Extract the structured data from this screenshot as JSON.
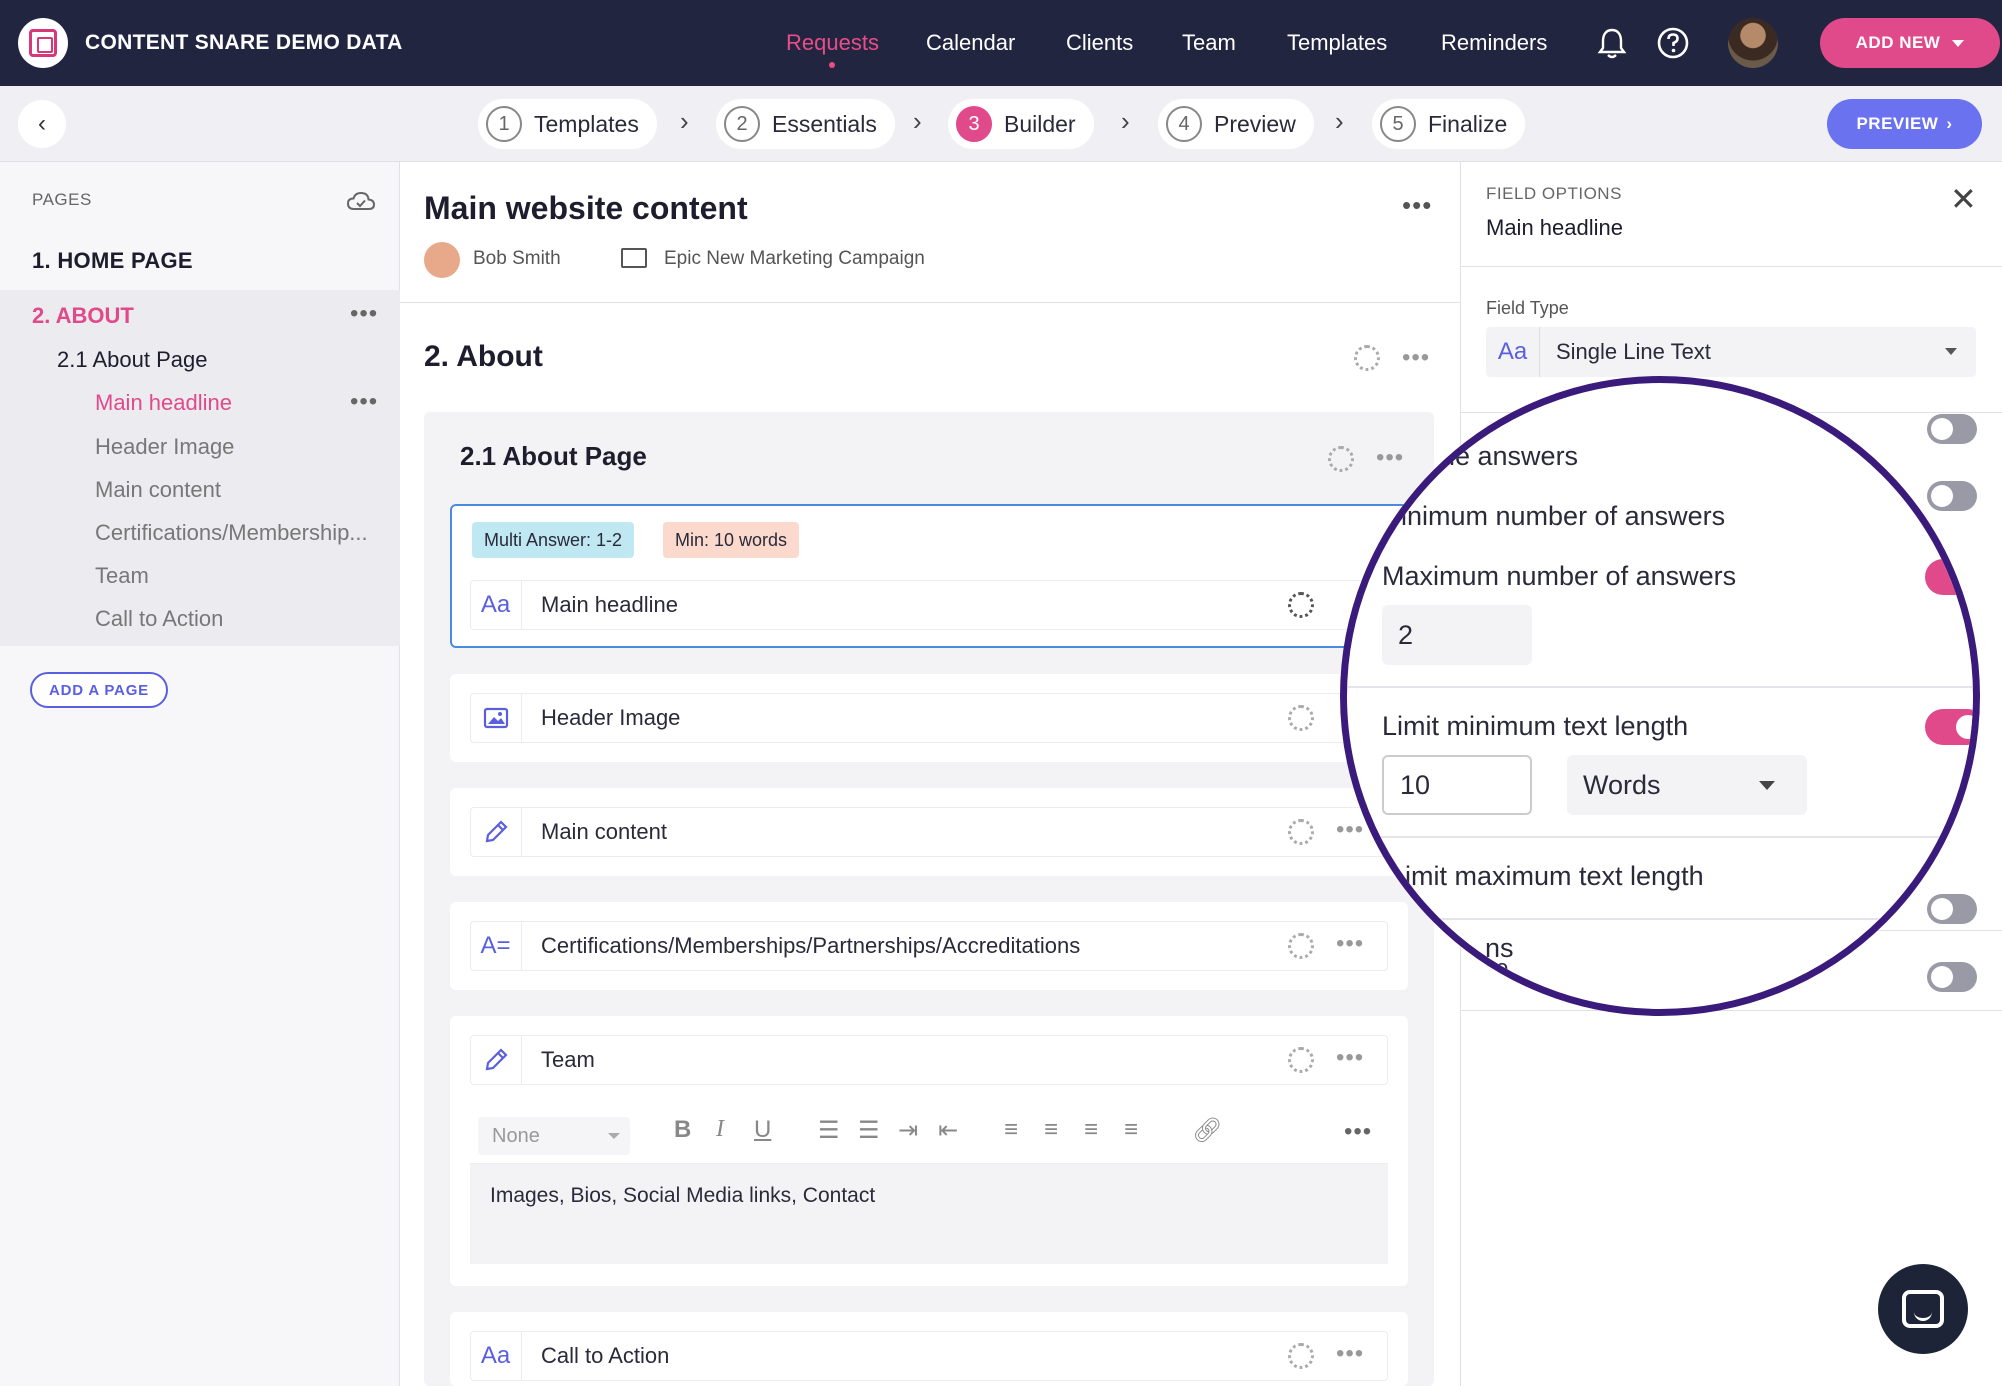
{
  "app": {
    "brand": "CONTENT SNARE DEMO DATA",
    "nav": [
      "Requests",
      "Calendar",
      "Clients",
      "Team",
      "Templates",
      "Reminders"
    ],
    "active_nav": "Requests",
    "add_new": "ADD NEW",
    "accent": "#e04a8a",
    "nav_bg": "#222540"
  },
  "steps": [
    {
      "num": "1",
      "label": "Templates"
    },
    {
      "num": "2",
      "label": "Essentials"
    },
    {
      "num": "3",
      "label": "Builder"
    },
    {
      "num": "4",
      "label": "Preview"
    },
    {
      "num": "5",
      "label": "Finalize"
    }
  ],
  "active_step": "Builder",
  "preview_btn": "PREVIEW",
  "sidebar": {
    "heading": "PAGES",
    "pages": [
      {
        "label": "1. HOME PAGE"
      },
      {
        "label": "2. ABOUT"
      }
    ],
    "subpage": "2.1 About Page",
    "fields": [
      "Main headline",
      "Header Image",
      "Main content",
      "Certifications/Membership...",
      "Team",
      "Call to Action"
    ],
    "add_page": "ADD A PAGE"
  },
  "main": {
    "title": "Main website content",
    "owner": "Bob Smith",
    "campaign": "Epic New Marketing Campaign",
    "section": "2.  About",
    "subsection": "2.1  About Page",
    "tags": [
      "Multi Answer: 1-2",
      "Min: 10 words"
    ],
    "fields": [
      {
        "label": "Main headline",
        "icon": "Aa"
      },
      {
        "label": "Header Image",
        "icon": "image-icon"
      },
      {
        "label": "Main content",
        "icon": "pencil-icon"
      },
      {
        "label": "Certifications/Memberships/Partnerships/Accreditations",
        "icon": "A="
      },
      {
        "label": "Team",
        "icon": "pencil-icon"
      },
      {
        "label": "Call to Action",
        "icon": "Aa"
      }
    ],
    "editor": {
      "style_select": "None",
      "content": "Images, Bios, Social Media links, Contact"
    }
  },
  "field_options": {
    "heading": "FIELD OPTIONS",
    "title": "Main headline",
    "field_type_label": "Field Type",
    "field_type": "Single Line Text",
    "field_type_icon": "Aa"
  },
  "magnifier": {
    "multiple_answers": "le answers",
    "min_answers": "inimum number of answers",
    "max_answers": "Maximum number of answers",
    "max_answers_value": "2",
    "limit_min_text": "Limit minimum text length",
    "min_text_value": "10",
    "min_text_unit": "Words",
    "limit_max_text": "imit maximum text length",
    "partial_1": "ns",
    "partial_2": "co"
  }
}
